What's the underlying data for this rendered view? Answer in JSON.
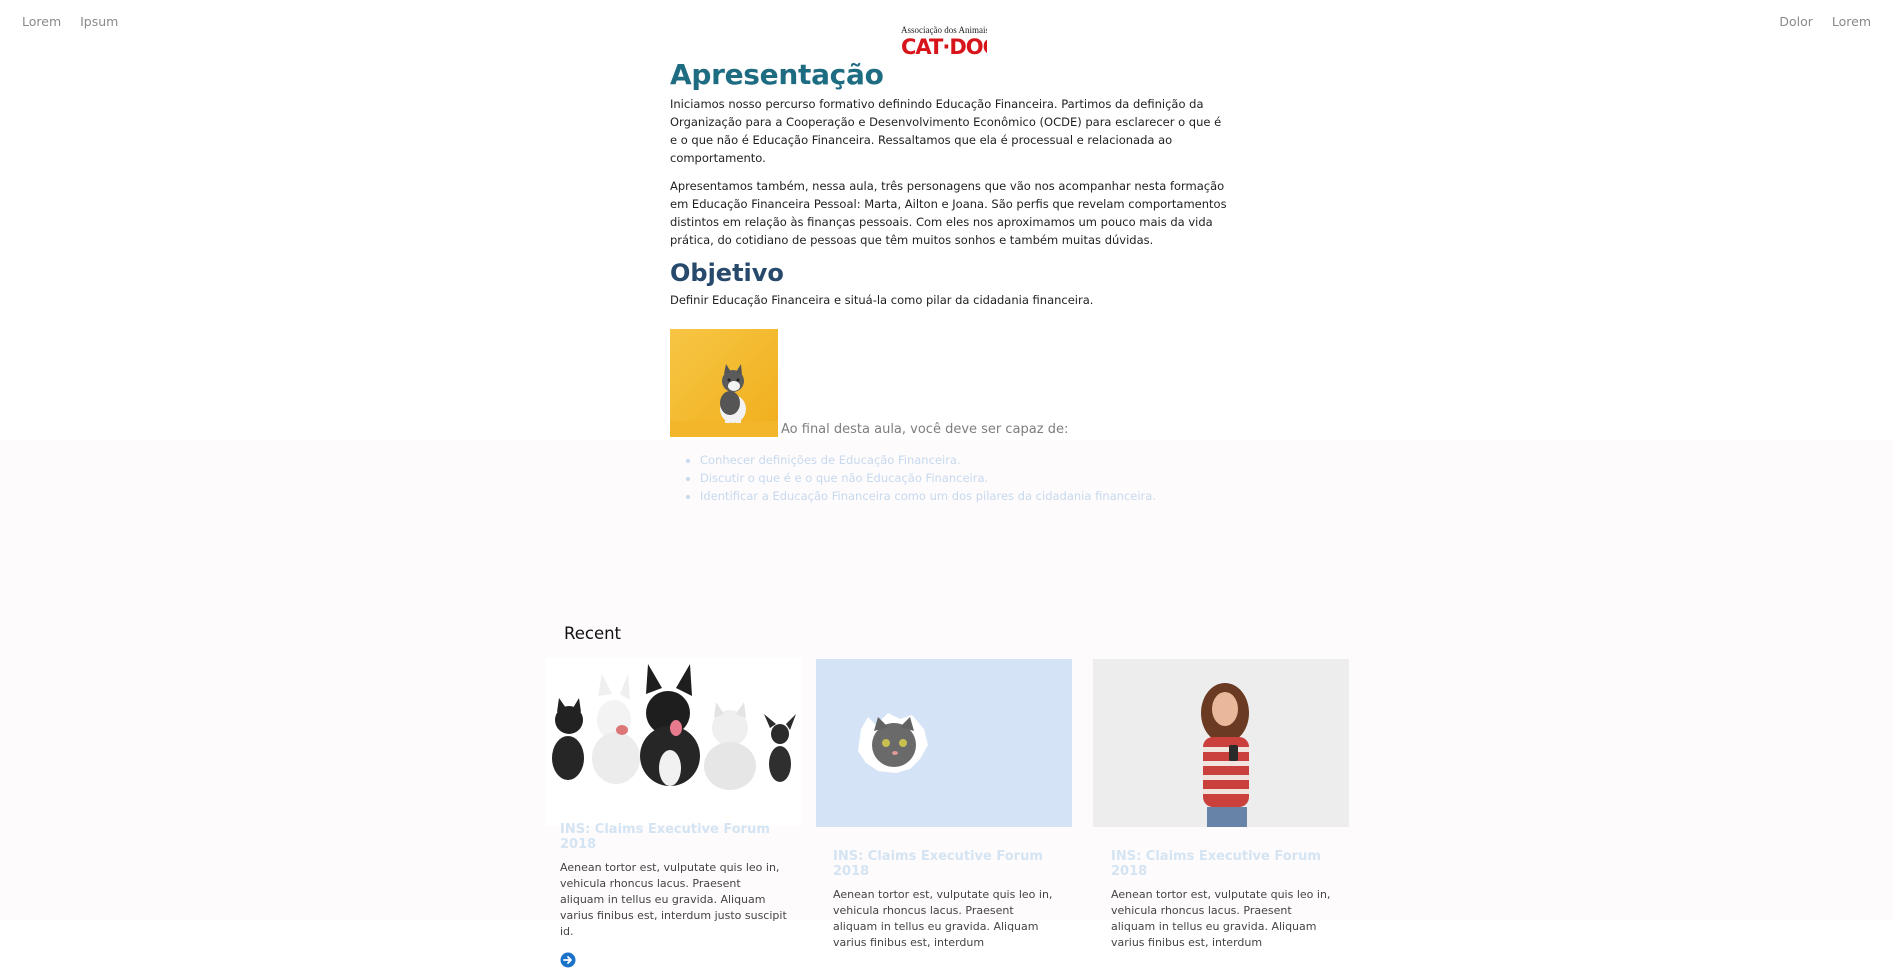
{
  "nav": {
    "left": [
      "Lorem",
      "Ipsum"
    ],
    "right": [
      "Dolor",
      "Lorem"
    ]
  },
  "logo": {
    "line1": "Associação dos Animais",
    "line2": "CAT·DOG",
    "color": "#d8141b"
  },
  "article": {
    "title": "Apresentação",
    "paragraph1": "Iniciamos nosso percurso formativo definindo Educação Financeira. Partimos da definição da Organização para a Cooperação e Desenvolvimento Econômico (OCDE) para esclarecer o que é e o que não é Educação Financeira. Ressaltamos que ela é processual e relacionada ao comportamento.",
    "paragraph2": "Apresentamos também, nessa aula, três personagens que vão nos acompanhar nesta formação em Educação Financeira Pessoal: Marta, Ailton e Joana. São perfis que revelam comportamentos distintos em relação às finanças pessoais. Com eles nos aproximamos um pouco mais da vida prática, do cotidiano de pessoas que têm muitos sonhos e também muitas dúvidas.",
    "objective_title": "Objetivo",
    "objective_text": "Definir Educação Financeira e situá-la como pilar da cidadania financeira.",
    "intro": "Ao final desta aula, você deve ser capaz de:",
    "goals": [
      "Conhecer definições de Educação Financeira.",
      "Discutir o que é e o que não Educação Financeira.",
      "Identificar a Educação Financeira como um dos pilares da cidadania financeira."
    ]
  },
  "recent": {
    "title": "Recent",
    "cards": [
      {
        "title": "INS: Claims Executive Forum 2018",
        "text": "Aenean tortor est, vulputate quis leo in, vehicula rhoncus lacus. Praesent aliquam in tellus eu gravida. Aliquam varius finibus est, interdum justo suscipit id."
      },
      {
        "title": "INS: Claims Executive Forum 2018",
        "text": "Aenean tortor est, vulputate quis leo in, vehicula rhoncus lacus. Praesent aliquam in tellus eu gravida. Aliquam varius finibus est, interdum"
      },
      {
        "title": "INS: Claims Executive Forum 2018",
        "text": "Aenean tortor est, vulputate quis leo in, vehicula rhoncus lacus. Praesent aliquam in tellus eu gravida. Aliquam varius finibus est, interdum"
      }
    ]
  },
  "colors": {
    "title_teal": "#1e6c82",
    "title_navy": "#27496b",
    "link_blue": "#1a73c9",
    "faded_blue": "#d4e4f3"
  }
}
